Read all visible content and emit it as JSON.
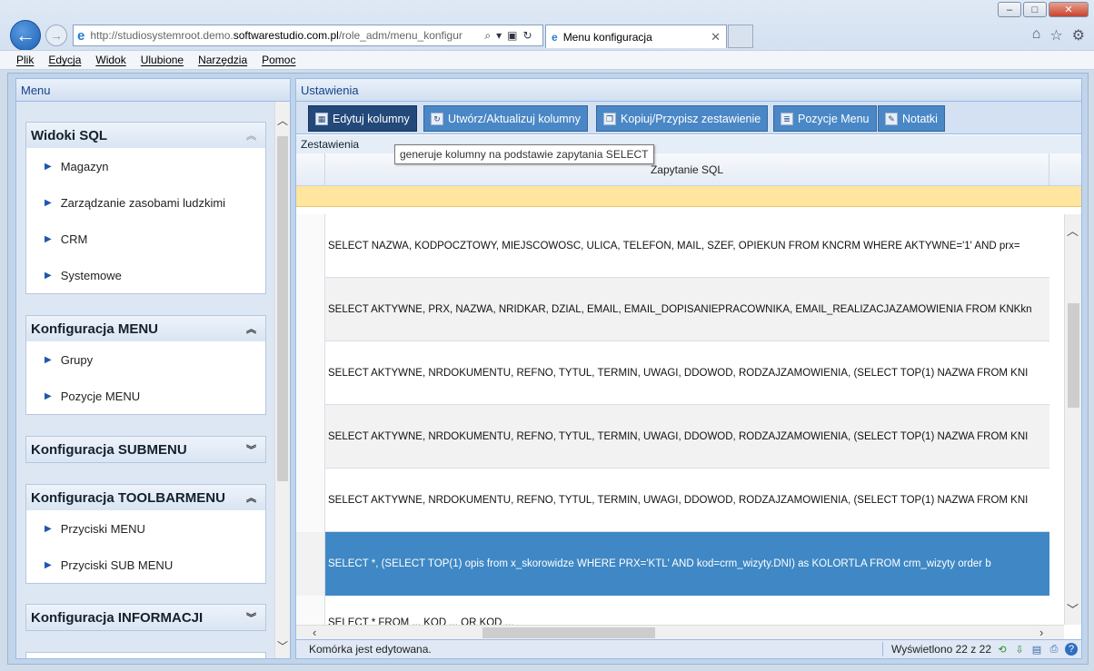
{
  "browser": {
    "url_prefix": "http://studiosystemroot.demo.",
    "url_domain": "softwarestudio.com.pl",
    "url_path": "/role_adm/menu_konfigur",
    "tab_title": "Menu konfiguracja",
    "menu": [
      "Plik",
      "Edycja",
      "Widok",
      "Ulubione",
      "Narzędzia",
      "Pomoc"
    ]
  },
  "left": {
    "title": "Menu",
    "groups": [
      {
        "title": "Widoki SQL",
        "items": [
          "Magazyn",
          "Zarządzanie zasobami ludzkimi",
          "CRM",
          "Systemowe"
        ]
      },
      {
        "title": "Konfiguracja MENU",
        "items": [
          "Grupy",
          "Pozycje MENU"
        ]
      },
      {
        "title": "Konfiguracja SUBMENU",
        "items": []
      },
      {
        "title": "Konfiguracja TOOLBARMENU",
        "items": [
          "Przyciski MENU",
          "Przyciski SUB MENU"
        ]
      },
      {
        "title": "Konfiguracja INFORMACJI",
        "items": []
      }
    ]
  },
  "right": {
    "title": "Ustawienia",
    "toolbar": [
      "Edytuj kolumny",
      "Utwórz/Aktualizuj kolumny",
      "Kopiuj/Przypisz zestawienie",
      "Pozycje Menu",
      "Notatki"
    ],
    "subtitle": "Zestawienia",
    "tooltip": "generuje kolumny na podstawie zapytania SELECT",
    "column_header": "Zapytanie SQL",
    "rows": [
      "SELECT NAZWA, KODPOCZTOWY, MIEJSCOWOSC, ULICA, TELEFON, MAIL, SZEF, OPIEKUN FROM KNCRM WHERE AKTYWNE='1' AND prx=",
      "SELECT AKTYWNE, PRX, NAZWA, NRIDKAR, DZIAL, EMAIL, EMAIL_DOPISANIEPRACOWNIKA, EMAIL_REALIZACJAZAMOWIENIA FROM KNKkn",
      "SELECT AKTYWNE, NRDOKUMENTU, REFNO, TYTUL, TERMIN, UWAGI, DDOWOD, RODZAJZAMOWIENIA, (SELECT TOP(1) NAZWA FROM KNI",
      "SELECT AKTYWNE, NRDOKUMENTU, REFNO, TYTUL, TERMIN, UWAGI, DDOWOD, RODZAJZAMOWIENIA, (SELECT TOP(1) NAZWA FROM KNI",
      "SELECT AKTYWNE, NRDOKUMENTU, REFNO, TYTUL, TERMIN, UWAGI, DDOWOD, RODZAJZAMOWIENIA, (SELECT TOP(1) NAZWA FROM KNI",
      "SELECT *, (SELECT TOP(1) opis from x_skorowidze WHERE PRX='KTL' AND kod=crm_wizyty.DNI) as KOLORTLA FROM crm_wizyty order b",
      "SELECT * FROM ... KOD ... OR KOD ..."
    ],
    "selected_row": 5,
    "status_left": "Komórka jest edytowana.",
    "status_right": "Wyświetlono 22 z 22"
  },
  "colors": {
    "accent": "#4a87c6",
    "selection": "#3f88c5",
    "filter_row": "#ffe59d",
    "panel_title": "#15428b"
  }
}
